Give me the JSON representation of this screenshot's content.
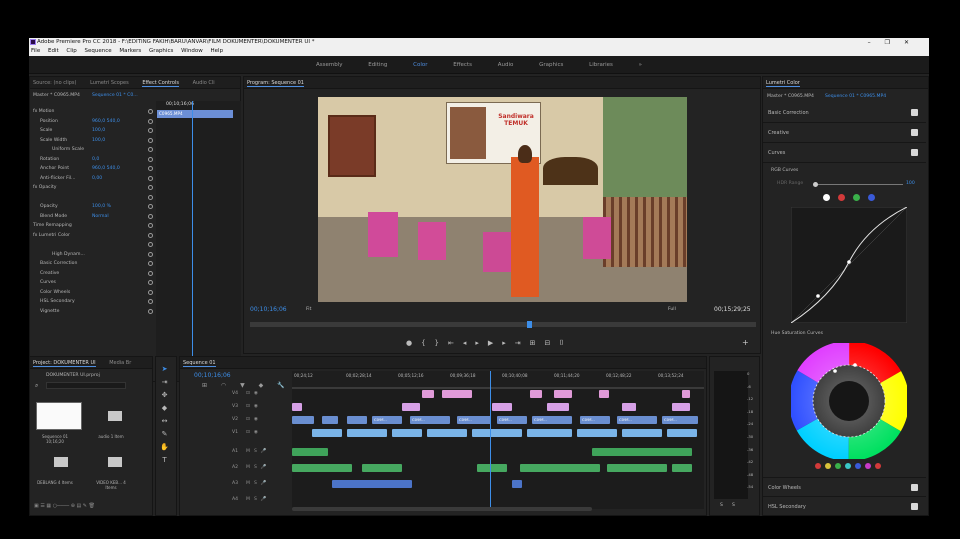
{
  "app": {
    "title": "Adobe Premiere Pro CC 2018 - F:\\EDITING FAKIH\\BARU\\ANVAR\\FILM DOKUMENTER\\DOKUMENTER UI *",
    "menu": [
      "File",
      "Edit",
      "Clip",
      "Sequence",
      "Markers",
      "Graphics",
      "Window",
      "Help"
    ],
    "workspaces": [
      "Assembly",
      "Editing",
      "Color",
      "Effects",
      "Audio",
      "Graphics",
      "Libraries"
    ],
    "active_workspace": "Color",
    "more_glyph": "»"
  },
  "left_panel": {
    "tabs": [
      "Source: (no clips)",
      "Lumetri Scopes",
      "Effect Controls",
      "Audio Cli"
    ],
    "active_tab": "Effect Controls",
    "master": "Master * C0965.MP4",
    "sequence": "Sequence 01 * C0...",
    "timecode": "00;10;16;06",
    "clip": "C0965.MP4",
    "section": "Video Effects",
    "rows": [
      {
        "label": "fx  Motion",
        "value": ""
      },
      {
        "label": "Position",
        "value": "960,0    540,0"
      },
      {
        "label": "Scale",
        "value": "100,0"
      },
      {
        "label": "Scale Width",
        "value": "100,0"
      },
      {
        "label": "Uniform Scale",
        "value": ""
      },
      {
        "label": "Rotation",
        "value": "0,0"
      },
      {
        "label": "Anchor Point",
        "value": "960,0    540,0"
      },
      {
        "label": "Anti-flicker Fil...",
        "value": "0,00"
      },
      {
        "label": "fx  Opacity",
        "value": ""
      },
      {
        "label": "",
        "value": ""
      },
      {
        "label": "Opacity",
        "value": "100,0 %"
      },
      {
        "label": "Blend Mode",
        "value": "Normal"
      },
      {
        "label": "Time Remapping",
        "value": ""
      },
      {
        "label": "fx  Lumetri Color",
        "value": ""
      },
      {
        "label": "",
        "value": ""
      },
      {
        "label": "High Dynam...",
        "value": ""
      },
      {
        "label": "Basic Correction",
        "value": ""
      },
      {
        "label": "Creative",
        "value": ""
      },
      {
        "label": "Curves",
        "value": ""
      },
      {
        "label": "Color Wheels",
        "value": ""
      },
      {
        "label": "HSL Secondary",
        "value": ""
      },
      {
        "label": "Vignette",
        "value": ""
      }
    ],
    "footer_timecode": "00;10;16;06"
  },
  "program": {
    "title": "Program: Sequence 01",
    "poster_text": "Sandiwara TEMUK",
    "timecode": "00;10;16;06",
    "fit": "Fit",
    "quality": "Full",
    "duration": "00;15;29;25"
  },
  "lumetri": {
    "title": "Lumetri Color",
    "master": "Master * C0965.MP4",
    "sequence": "Sequence 01 * C0965.MP4",
    "items": [
      "Basic Correction",
      "Creative",
      "Curves"
    ],
    "rgb_curves": "RGB Curves",
    "hdr_range": "HDR Range",
    "hdr_value": "100",
    "hue_sat": "Hue Saturation Curves",
    "bottom_items": [
      "Color Wheels",
      "HSL Secondary"
    ],
    "channel_colors": [
      "#ffffff",
      "#d23a3a",
      "#3ab04a",
      "#3a5ad8"
    ],
    "hue_dots": [
      "#d23a3a",
      "#d8c23a",
      "#3ab04a",
      "#3ac8c8",
      "#3a5ad8",
      "#c83ac8",
      "#d23a3a"
    ]
  },
  "project": {
    "tabs": [
      "Project: DOKUMENTER UI",
      "Media Br"
    ],
    "name": "DOKUMENTER UI.prproj",
    "items": [
      {
        "label": "Sequence 01",
        "meta": "10;16;20"
      },
      {
        "label": "audio",
        "meta": "1 Item"
      },
      {
        "label": "DEBLANG",
        "meta": "4 Items"
      },
      {
        "label": "VIDEO KEB...",
        "meta": "4 Items"
      }
    ]
  },
  "timeline": {
    "title": "Sequence 01",
    "timecode": "00;10;16;06",
    "ruler": [
      "00;24;12",
      "00;02;28;14",
      "00;05;12;16",
      "00;09;36;18",
      "00;10;40;08",
      "00;11;44;20",
      "00;12;48;22",
      "00;13;52;24"
    ],
    "video_tracks": [
      "V4",
      "V3",
      "V2",
      "V1"
    ],
    "audio_tracks": [
      "A1",
      "A2",
      "A3",
      "A4"
    ],
    "clip_label": "C09F...",
    "meter_db": [
      "0",
      "-6",
      "-12",
      "-18",
      "-24",
      "-30",
      "-36",
      "-42",
      "-48",
      "-54"
    ],
    "meter_footer": [
      "S",
      "S"
    ]
  }
}
